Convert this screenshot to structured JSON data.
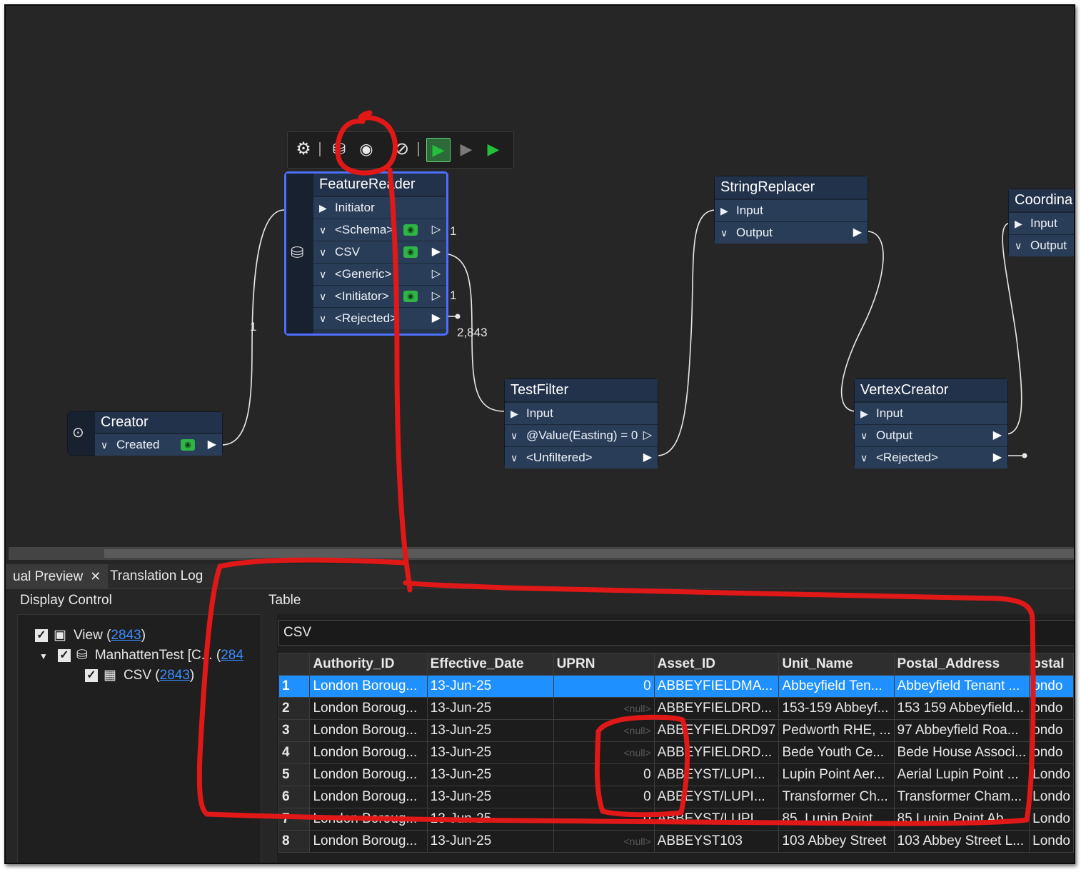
{
  "canvas": {
    "toolbar": {
      "items": [
        "gear-icon",
        "cache-icon",
        "inspect-cached-icon",
        "disable-icon",
        "run-to-this-icon",
        "run-this-icon",
        "run-from-this-icon"
      ]
    },
    "feature_reader": {
      "title": "FeatureReader",
      "ports": [
        {
          "label": "Initiator",
          "kind": "input"
        },
        {
          "label": "<Schema>",
          "kind": "output",
          "count": "1"
        },
        {
          "label": "CSV",
          "kind": "output",
          "count": ""
        },
        {
          "label": "<Generic>",
          "kind": "output",
          "count": ""
        },
        {
          "label": "<Initiator>",
          "kind": "output",
          "count": "1"
        },
        {
          "label": "<Rejected>",
          "kind": "output",
          "count": ""
        }
      ]
    },
    "creator": {
      "title": "Creator",
      "port": "Created"
    },
    "test_filter": {
      "title": "TestFilter",
      "ports": [
        "Input",
        "@Value(Easting) = 0",
        "<Unfiltered>"
      ]
    },
    "string_replacer": {
      "title": "StringReplacer",
      "ports": [
        "Input",
        "Output"
      ]
    },
    "vertex_creator": {
      "title": "VertexCreator",
      "ports": [
        "Input",
        "Output",
        "<Rejected>"
      ]
    },
    "coordinate": {
      "title": "Coordina",
      "ports": [
        "Input",
        "Output"
      ]
    },
    "link_labels": {
      "creator_to_reader": "1",
      "csv_count": "2,843"
    }
  },
  "bottom": {
    "tabs": [
      {
        "label": "ual Preview",
        "active": true,
        "closable": true
      },
      {
        "label": "Translation Log",
        "active": false
      }
    ],
    "display_control": {
      "title": "Display Control",
      "rows": [
        {
          "label": "View (",
          "count": "2843",
          "suffix": ")"
        },
        {
          "label": "ManhattenTest [C",
          "middle": "... (",
          "count": "284",
          "suffix": ""
        },
        {
          "label": "CSV (",
          "count": "2843",
          "suffix": ")"
        }
      ]
    },
    "table": {
      "title": "Table",
      "source": "CSV",
      "columns": [
        "",
        "Authority_ID",
        "Effective_Date",
        "UPRN",
        "Asset_ID",
        "Unit_Name",
        "Postal_Address",
        "ostal"
      ],
      "rows": [
        [
          "1",
          "London Boroug...",
          "13-Jun-25",
          "0",
          "ABBEYFIELDMA...",
          "Abbeyfield Ten...",
          "Abbeyfield Tenant ...",
          "ondo"
        ],
        [
          "2",
          "London Boroug...",
          "13-Jun-25",
          "<null>",
          "ABBEYFIELDRD...",
          "153-159 Abbeyf...",
          "153 159 Abbeyfield...",
          "ondo"
        ],
        [
          "3",
          "London Boroug...",
          "13-Jun-25",
          "<null>",
          "ABBEYFIELDRD97",
          "Pedworth RHE, ...",
          "97 Abbeyfield Roa...",
          "ondo"
        ],
        [
          "4",
          "London Boroug...",
          "13-Jun-25",
          "<null>",
          "ABBEYFIELDRD...",
          "Bede Youth Ce...",
          "Bede House Associ...",
          "ondo"
        ],
        [
          "5",
          "London Boroug...",
          "13-Jun-25",
          "0",
          "ABBEYST/LUPI...",
          "Lupin Point Aer...",
          "Aerial Lupin Point ...",
          "Londo"
        ],
        [
          "6",
          "London Boroug...",
          "13-Jun-25",
          "0",
          "ABBEYST/LUPI...",
          "Transformer Ch...",
          "Transformer Cham...",
          "Londo"
        ],
        [
          "7",
          "London Boroug...",
          "13-Jun-25",
          "0",
          "ABBEYST/LUPI...",
          "85, Lupin Point,...",
          "85 Lupin Point Ab...",
          "Londo"
        ],
        [
          "8",
          "London Boroug...",
          "13-Jun-25",
          "<null>",
          "ABBEYST103",
          "103 Abbey Street",
          "103 Abbey Street L...",
          "Londo"
        ]
      ],
      "selected_row": 0
    }
  },
  "colors": {
    "accent_selection": "#1e90ff",
    "annotation_red": "#e01818",
    "node_blue": "#2a3d58",
    "eye_green": "#2fb545"
  }
}
